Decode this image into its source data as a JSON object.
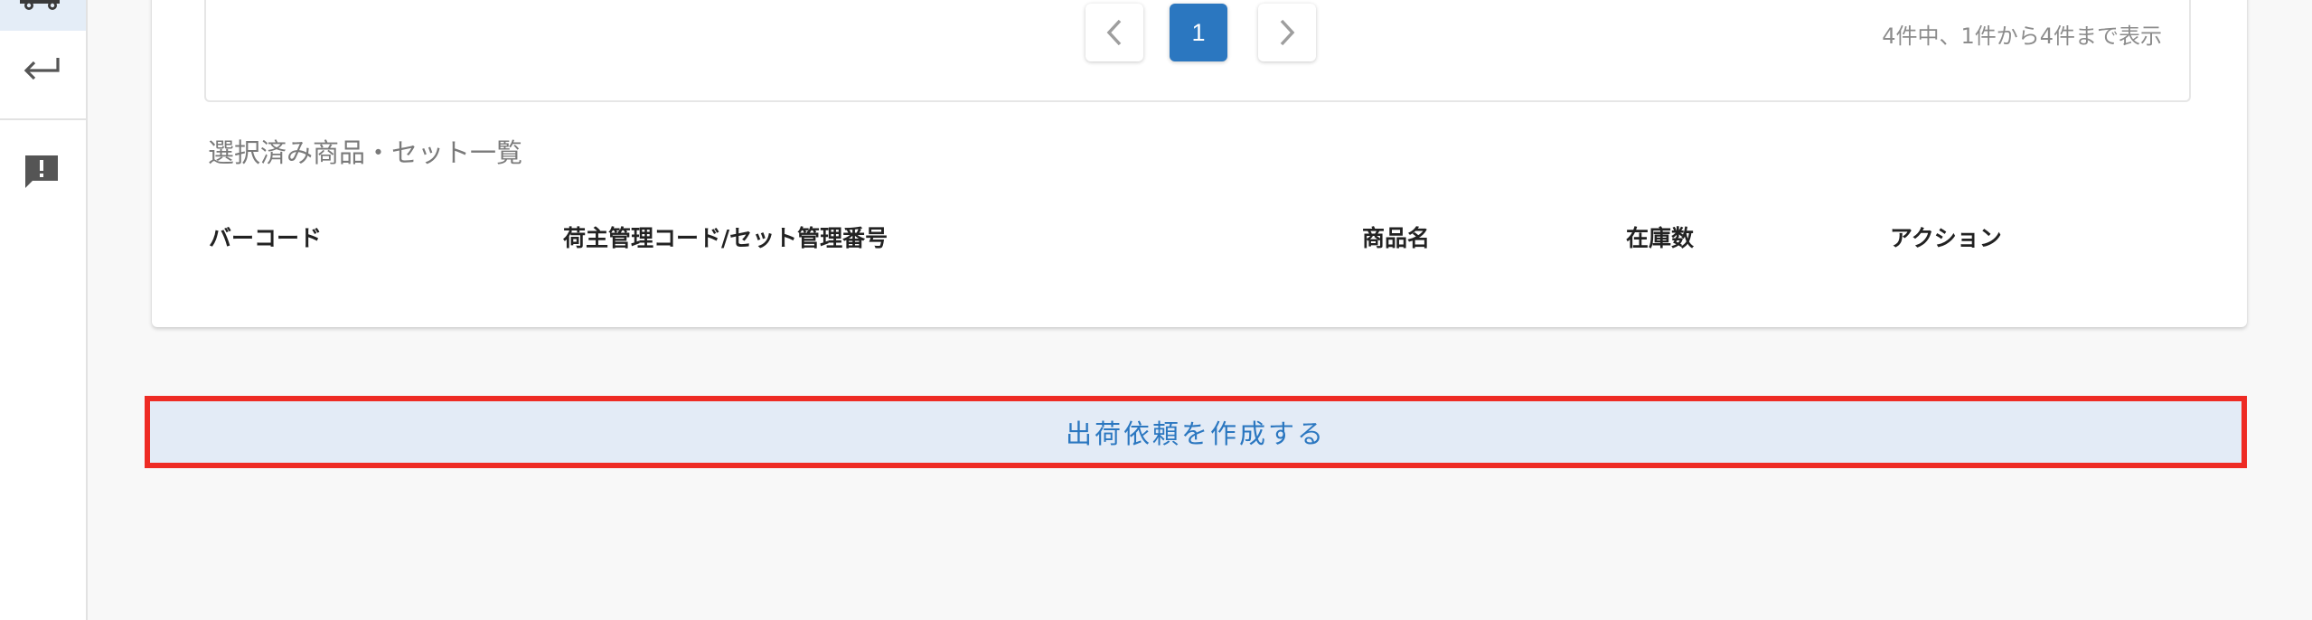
{
  "sidebar": {
    "items": [
      {
        "icon": "truck-icon",
        "active": true
      },
      {
        "icon": "return-icon",
        "active": false
      },
      {
        "icon": "feedback-icon",
        "active": false
      }
    ]
  },
  "pagination": {
    "prev_icon": "chevron-left-icon",
    "current_page": "1",
    "next_icon": "chevron-right-icon",
    "info": "4件中、1件から4件まで表示"
  },
  "selected_list": {
    "title": "選択済み商品・セット一覧",
    "columns": [
      "バーコード",
      "荷主管理コード/セット管理番号",
      "商品名",
      "在庫数",
      "アクション"
    ],
    "rows": []
  },
  "actions": {
    "create_shipping_request": "出荷依頼を作成する"
  },
  "colors": {
    "accent": "#2b77c0",
    "highlight_border": "#ee2b24",
    "button_bg": "#e3ebf6"
  }
}
